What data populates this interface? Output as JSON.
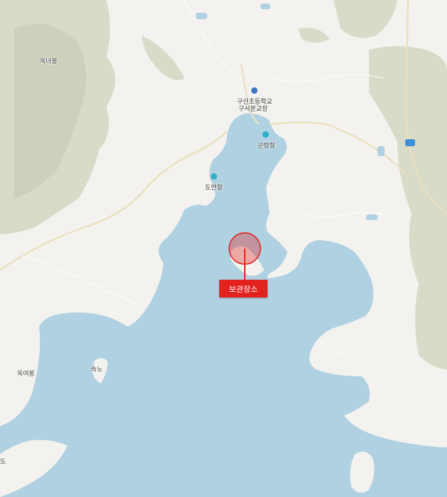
{
  "map": {
    "colors": {
      "land": "#f4f2ee",
      "water": "#b0d1e2",
      "hills": "#d9dcca",
      "hills_dark": "#cbd0b8",
      "road": "#e9dcb8",
      "marker": "#e3211f"
    },
    "labels": {
      "peak_1": "옥녀봉",
      "school": "구산초등학교",
      "school_branch": "구서분교장",
      "port_1": "군령항",
      "port_2": "도만항",
      "peak_2": "옥여봉",
      "island": "숙노",
      "edge": "도"
    },
    "icons": {
      "school_icon": "school-icon",
      "port_icon": "anchor-icon",
      "highway_icon": "highway-shield-icon"
    },
    "marker": {
      "label": "보관장소"
    }
  }
}
